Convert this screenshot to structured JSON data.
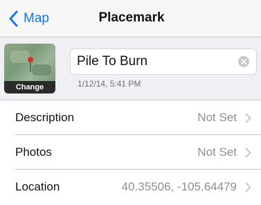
{
  "nav": {
    "back_label": "Map",
    "title": "Placemark"
  },
  "header": {
    "thumbnail_action": "Change",
    "name_value": "Pile To Burn",
    "timestamp": "1/12/14, 5:41 PM"
  },
  "rows": [
    {
      "label": "Description",
      "value": "Not Set"
    },
    {
      "label": "Photos",
      "value": "Not Set"
    },
    {
      "label": "Location",
      "value": "40.35506, -105.64479"
    }
  ],
  "colors": {
    "accent": "#1577f5",
    "pin": "#d9312b",
    "secondary_text": "#8e8e93",
    "background": "#efeff4"
  },
  "icons": [
    "back-chevron-icon",
    "map-pin-icon",
    "clear-icon",
    "chevron-right-icon"
  ]
}
